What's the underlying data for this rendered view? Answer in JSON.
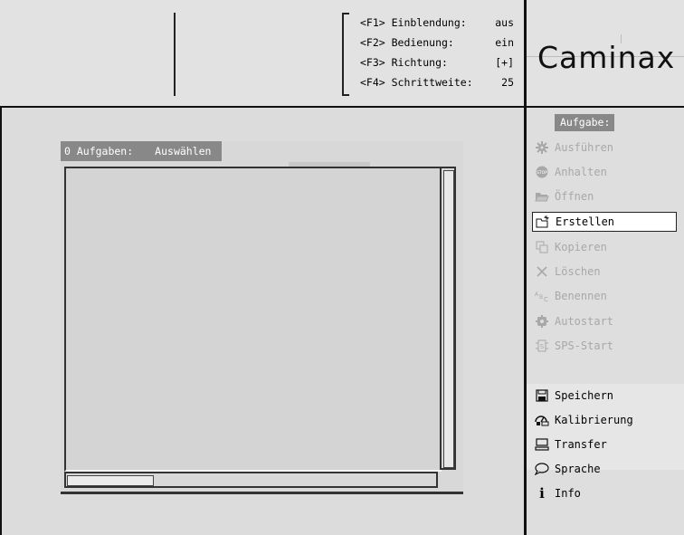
{
  "status": {
    "fkeys": [
      {
        "key": "<F1> Einblendung:",
        "value": "aus"
      },
      {
        "key": "<F2> Bedienung:",
        "value": "ein"
      },
      {
        "key": "<F3> Richtung:",
        "value": "[+]"
      },
      {
        "key": "<F4> Schrittweite:",
        "value": "25"
      }
    ]
  },
  "logo": {
    "text": "Caminax"
  },
  "panel": {
    "count_label": "0 Aufgaben:",
    "select_label": "Auswählen"
  },
  "sidebar": {
    "header": "Aufgabe:",
    "items": [
      {
        "label": "Ausführen",
        "icon": "gear-icon"
      },
      {
        "label": "Anhalten",
        "icon": "stop-icon"
      },
      {
        "label": "Öffnen",
        "icon": "folder-open-icon"
      },
      {
        "label": "Erstellen",
        "icon": "new-folder-icon"
      },
      {
        "label": "Kopieren",
        "icon": "copy-icon"
      },
      {
        "label": "Löschen",
        "icon": "delete-icon"
      },
      {
        "label": "Benennen",
        "icon": "rename-icon"
      },
      {
        "label": "Autostart",
        "icon": "autostart-icon"
      },
      {
        "label": "SPS-Start",
        "icon": "sps-start-icon"
      },
      {
        "label": "Speichern",
        "icon": "save-icon"
      },
      {
        "label": "Kalibrierung",
        "icon": "calibration-icon"
      },
      {
        "label": "Transfer",
        "icon": "transfer-icon"
      },
      {
        "label": "Sprache",
        "icon": "speech-icon"
      },
      {
        "label": "Info",
        "icon": "info-icon"
      }
    ]
  }
}
